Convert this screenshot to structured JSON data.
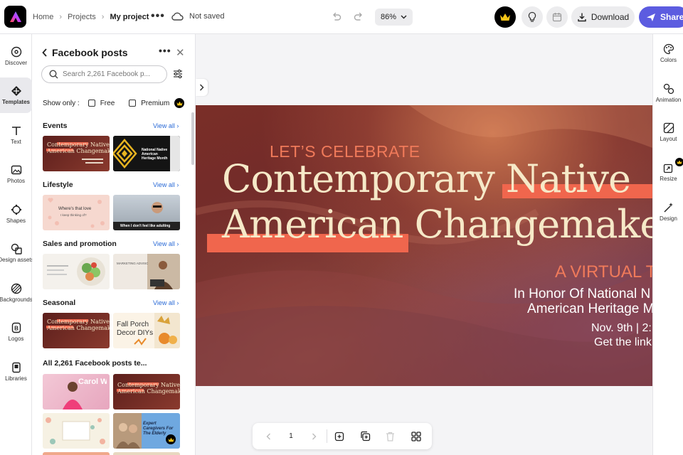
{
  "topbar": {
    "breadcrumb": [
      "Home",
      "Projects",
      "My project"
    ],
    "save_status": "Not saved",
    "zoom": "86%",
    "download_label": "Download",
    "share_label": "Share"
  },
  "left_rail": {
    "items": [
      {
        "label": "Discover",
        "icon": "compass-icon"
      },
      {
        "label": "Templates",
        "icon": "templates-icon",
        "active": true
      },
      {
        "label": "Text",
        "icon": "text-icon"
      },
      {
        "label": "Photos",
        "icon": "photo-icon"
      },
      {
        "label": "Shapes",
        "icon": "shapes-icon"
      },
      {
        "label": "Design assets",
        "icon": "design-assets-icon"
      },
      {
        "label": "Backgrounds",
        "icon": "backgrounds-icon"
      },
      {
        "label": "Logos",
        "icon": "logo-icon"
      },
      {
        "label": "Libraries",
        "icon": "libraries-icon"
      }
    ]
  },
  "panel": {
    "title": "Facebook posts",
    "search_placeholder": "Search 2,261 Facebook p...",
    "show_only_label": "Show only :",
    "filter_free": "Free",
    "filter_premium": "Premium",
    "view_all": "View all",
    "sections": [
      {
        "title": "Events"
      },
      {
        "title": "Lifestyle"
      },
      {
        "title": "Sales and promotion"
      },
      {
        "title": "Seasonal"
      },
      {
        "title": "All 2,261 Facebook posts te..."
      }
    ],
    "thumb_text": {
      "changemakers_1": "Contemporary Native",
      "changemakers_2": "American Changemakers",
      "native_heritage": "National Native American Heritage Month",
      "lifestyle_love": "Where's that love",
      "lifestyle_sub": "I keep thinking of?",
      "adulting": "When I don't feel like adulting",
      "marketing": "MARKETING ADVISORS",
      "fall_1": "Fall Porch",
      "fall_2": "Decor DIYs",
      "carol": "Carol Williams",
      "caregivers": "Expert Caregivers For The Elderly"
    }
  },
  "canvas": {
    "line1": "LET’S CELEBRATE",
    "line2": "Contemporary Native",
    "line3": "American Changemake",
    "line4": "A VIRTUAL T",
    "line5": "In Honor Of National N",
    "line6": "American Heritage M",
    "line7": "Nov. 9th | 2:",
    "line8": "Get the link"
  },
  "right_rail": {
    "items": [
      {
        "label": "Colors",
        "icon": "palette-icon"
      },
      {
        "label": "Animation",
        "icon": "animation-icon"
      },
      {
        "label": "Layout",
        "icon": "layout-icon"
      },
      {
        "label": "Resize",
        "icon": "resize-icon"
      },
      {
        "label": "Design",
        "icon": "magic-wand-icon"
      }
    ]
  },
  "pager": {
    "page_number": "1"
  },
  "colors": {
    "accent": "#5c5ce0",
    "canvas_highlight": "#f0664d",
    "canvas_title": "#f6e9c8"
  }
}
